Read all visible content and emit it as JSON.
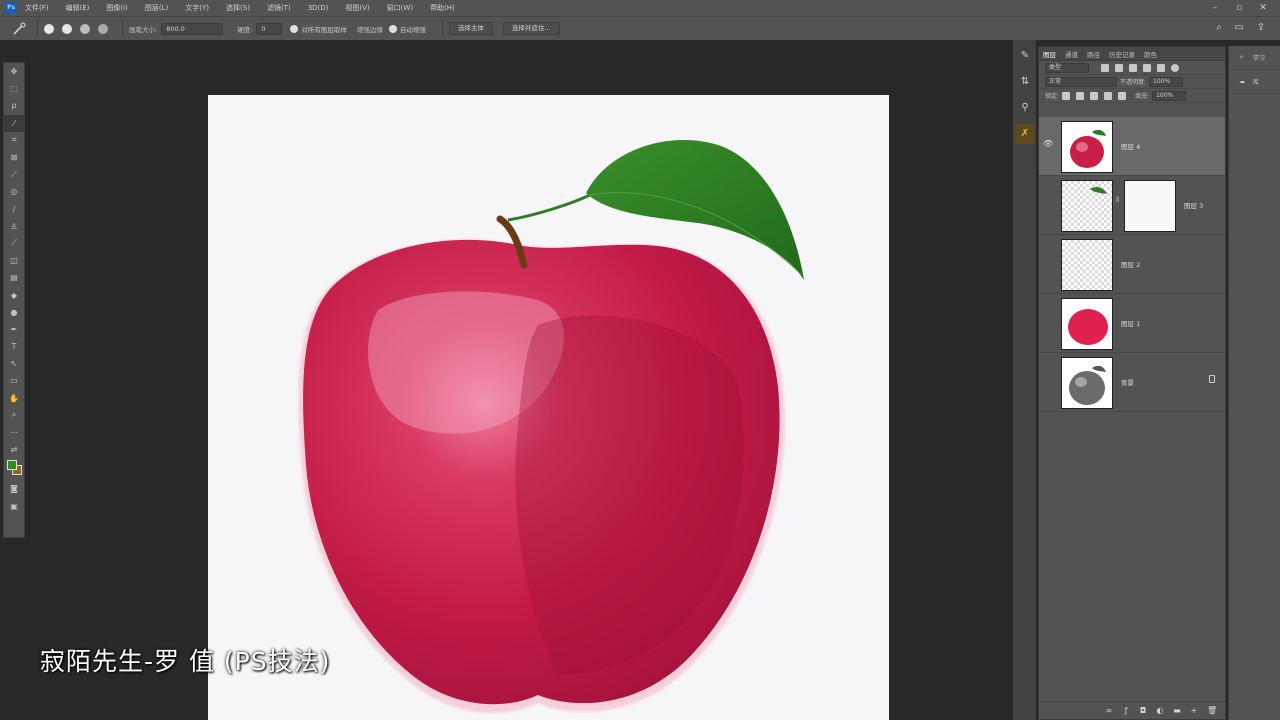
{
  "menubar": {
    "items": [
      "文件(F)",
      "编辑(E)",
      "图像(I)",
      "图层(L)",
      "文字(Y)",
      "选择(S)",
      "滤镜(T)",
      "3D(D)",
      "视图(V)",
      "窗口(W)",
      "帮助(H)"
    ]
  },
  "options": {
    "brush_size_label": "画笔大小:",
    "mode_value": "800.0",
    "hardness_label": "硬度:",
    "hardness_value": "0",
    "sample_all_label": "对所有图层取样",
    "enhance_label": "增强边缘",
    "auto_enhance_label": "自动增强",
    "select_subject_label": "选择主体",
    "select_mask_label": "选择并遮住..."
  },
  "panel": {
    "tabs": [
      "图层",
      "通道",
      "路径",
      "历史记录",
      "颜色"
    ],
    "kind_filter": "类型",
    "blend_mode": "正常",
    "opacity_label": "不透明度:",
    "opacity_value": "100%",
    "lock_label": "锁定:",
    "fill_label": "填充:",
    "fill_value": "100%"
  },
  "layers": [
    {
      "name": "图层 4",
      "selected": true,
      "thumb": "apple-red"
    },
    {
      "name": "图层 3",
      "selected": false,
      "thumb": "leaf-transparent",
      "has_mask": true
    },
    {
      "name": "图层 2",
      "selected": false,
      "thumb": "transparent"
    },
    {
      "name": "图层 1",
      "selected": false,
      "thumb": "red-blob"
    },
    {
      "name": "背景",
      "selected": false,
      "thumb": "apple-gray",
      "locked": true
    }
  ],
  "farpanel": {
    "learn_label": "学习",
    "libraries_label": "库"
  },
  "watermark": "寂陌先生-罗 值 (PS技法)",
  "colors": {
    "foreground": "#2f8a1f",
    "background": "#8b6a1a",
    "apple": "#c81f49",
    "leaf": "#2e7d22"
  }
}
